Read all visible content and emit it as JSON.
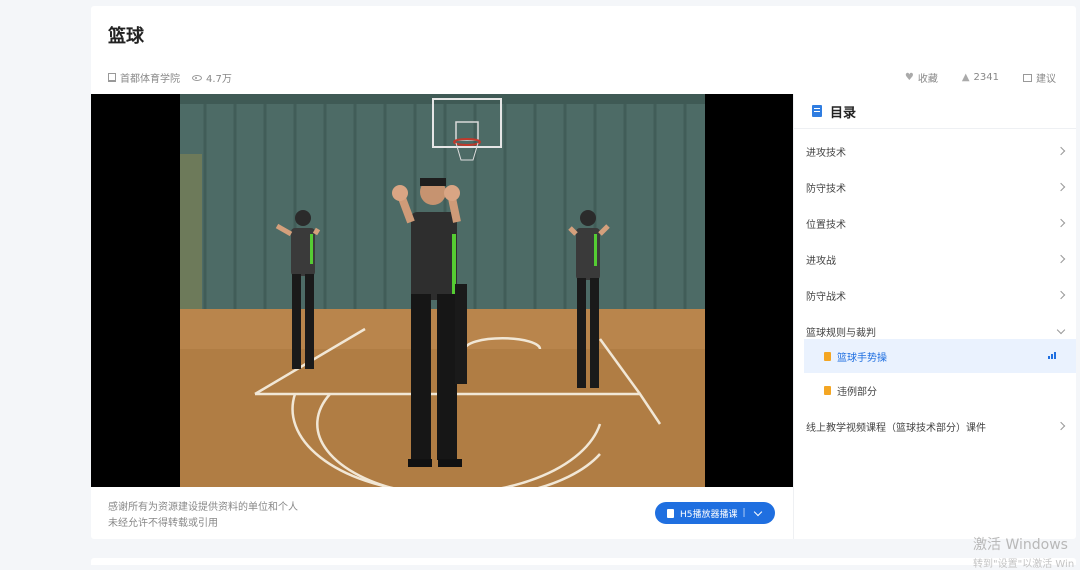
{
  "course": {
    "title": "篮球",
    "institution": "首都体育学院",
    "views": "4.7万",
    "favorite_label": "收藏",
    "likes": "2341",
    "feedback_label": "建议"
  },
  "video": {
    "credit_line1": "感谢所有为资源建设提供资料的单位和个人",
    "credit_line2": "未经允许不得转载或引用",
    "player_button_label": "H5播放器播课"
  },
  "toc": {
    "title": "目录",
    "items": [
      {
        "label": "进攻技术"
      },
      {
        "label": "防守技术"
      },
      {
        "label": "位置技术"
      },
      {
        "label": "进攻战"
      },
      {
        "label": "防守战术"
      },
      {
        "label": "篮球规则与裁判"
      },
      {
        "label": "线上教学视频课程（篮球技术部分）课件"
      }
    ],
    "sub_items": [
      {
        "label": "篮球手势操",
        "active": true
      },
      {
        "label": "违例部分",
        "active": false
      }
    ]
  },
  "watermark": {
    "title": "激活 Windows",
    "subtitle": "转到\"设置\"以激活 Win"
  },
  "colors": {
    "accent": "#1f6fe0",
    "doc_icon": "#f4a623",
    "active_bg": "#eaf2fe"
  }
}
